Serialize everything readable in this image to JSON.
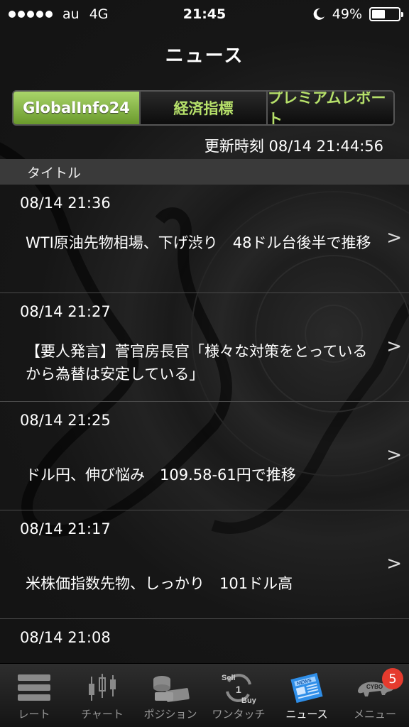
{
  "status_bar": {
    "carrier": "au",
    "network": "4G",
    "time": "21:45",
    "battery": "49%",
    "battery_level": 0.49
  },
  "nav": {
    "title": "ニュース"
  },
  "tabs": [
    {
      "label": "GlobalInfo24",
      "active": true
    },
    {
      "label": "経済指標",
      "active": false
    },
    {
      "label": "プレミアムレポート",
      "active": false
    }
  ],
  "updated": "更新時刻 08/14 21:44:56",
  "section_header": "タイトル",
  "news": [
    {
      "time": "08/14 21:36",
      "title": "WTI原油先物相場、下げ渋り　48ドル台後半で推移"
    },
    {
      "time": "08/14 21:27",
      "title": "【要人発言】菅官房長官「様々な対策をとっているから為替は安定している」"
    },
    {
      "time": "08/14 21:25",
      "title": "ドル円、伸び悩み　109.58-61円で推移"
    },
    {
      "time": "08/14 21:17",
      "title": "米株価指数先物、しっかり　101ドル高"
    },
    {
      "time": "08/14 21:08",
      "title": ""
    }
  ],
  "chevron": ">",
  "tab_bar": [
    {
      "label": "レート",
      "icon": "rate-list-icon"
    },
    {
      "label": "チャート",
      "icon": "candlestick-chart-icon"
    },
    {
      "label": "ポジション",
      "icon": "coins-icon"
    },
    {
      "label": "ワンタッチ",
      "icon": "sell-buy-icon",
      "icon_text_sell": "Sell",
      "icon_text_buy": "Buy",
      "icon_text_num": "1"
    },
    {
      "label": "ニュース",
      "icon": "newspaper-icon",
      "icon_text": "NEWS",
      "active": true
    },
    {
      "label": "メニュー",
      "icon": "cybo-logo-icon",
      "icon_text": "CYBO",
      "badge": "5"
    }
  ],
  "colors": {
    "accent_green": "#8cc04a",
    "tab_text_green": "#b6e06a",
    "badge_red": "#e53b2e",
    "news_icon_blue": "#2f8ee8"
  }
}
